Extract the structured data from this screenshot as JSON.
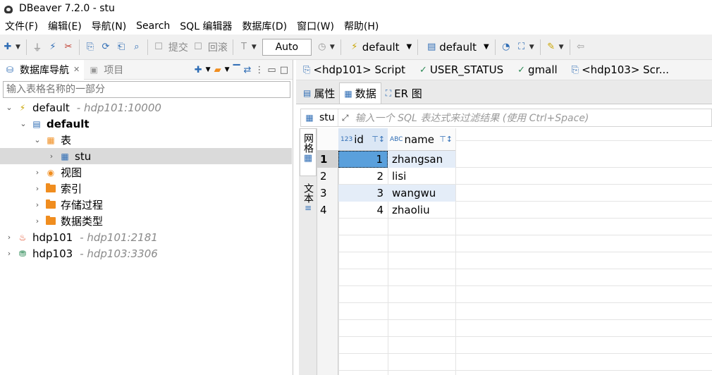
{
  "window": {
    "title": "DBeaver 7.2.0 - stu"
  },
  "menu": [
    "文件(F)",
    "编辑(E)",
    "导航(N)",
    "Search",
    "SQL 编辑器",
    "数据库(D)",
    "窗口(W)",
    "帮助(H)"
  ],
  "toolbar": {
    "commit_label": "提交",
    "rollback_label": "回滚",
    "tx_mode": "Auto",
    "datasource": "default",
    "schema": "default"
  },
  "left_panel": {
    "tab_navigator": "数据库导航",
    "tab_projects": "项目",
    "filter_placeholder": "输入表格名称的一部分",
    "tree": {
      "conn_default": {
        "label": "default",
        "host": "- hdp101:10000"
      },
      "schema_default": "default",
      "tables_folder": "表",
      "table_stu": "stu",
      "views": "视图",
      "indexes": "索引",
      "procedures": "存储过程",
      "datatypes": "数据类型",
      "conn_hdp101": {
        "label": "hdp101",
        "host": "- hdp101:2181"
      },
      "conn_hdp103": {
        "label": "hdp103",
        "host": "- hdp103:3306"
      }
    }
  },
  "editor_tabs": [
    "<hdp101> Script",
    "USER_STATUS",
    "gmall",
    "<hdp103> Scr..."
  ],
  "sub_tabs": {
    "properties": "属性",
    "data": "数据",
    "er": "ER 图"
  },
  "filter_bar": {
    "table": "stu",
    "placeholder": "输入一个 SQL 表达式来过滤结果 (使用 Ctrl+Space)"
  },
  "view_tabs": {
    "grid": "网格",
    "text": "文本"
  },
  "results": {
    "columns": [
      {
        "type": "123",
        "name": "id"
      },
      {
        "type": "ABC",
        "name": "name"
      }
    ],
    "rows": [
      {
        "n": "1",
        "id": "1",
        "name": "zhangsan"
      },
      {
        "n": "2",
        "id": "2",
        "name": "lisi"
      },
      {
        "n": "3",
        "id": "3",
        "name": "wangwu"
      },
      {
        "n": "4",
        "id": "4",
        "name": "zhaoliu"
      }
    ]
  }
}
